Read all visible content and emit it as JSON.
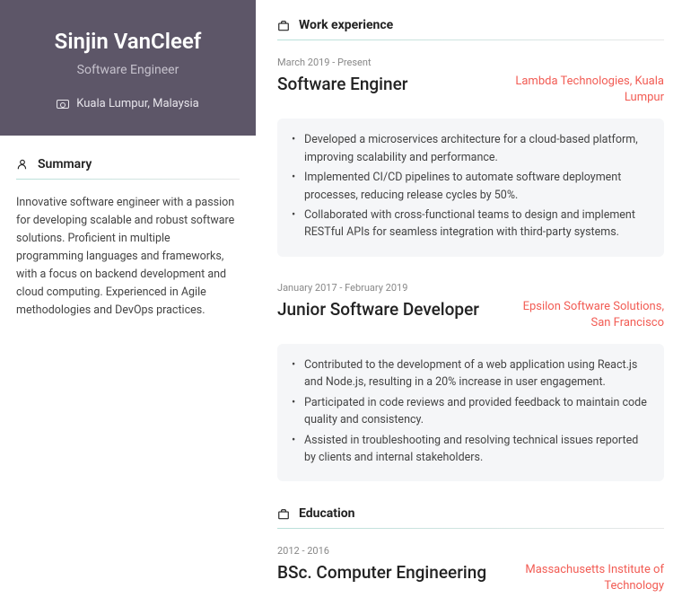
{
  "profile": {
    "name": "Sinjin VanCleef",
    "title": "Software Engineer",
    "location": "Kuala Lumpur, Malaysia"
  },
  "summary": {
    "heading": "Summary",
    "text": "Innovative software engineer with a passion for developing scalable and robust software solutions. Proficient in multiple programming languages and frameworks, with a focus on backend development and cloud computing. Experienced in Agile methodologies and DevOps practices."
  },
  "experience": {
    "heading": "Work experience",
    "jobs": [
      {
        "dates": "March 2019 - Present",
        "title": "Software Enginer",
        "company": "Lambda Technologies, Kuala Lumpur",
        "bullets": [
          "Developed a microservices architecture for a cloud-based platform, improving scalability and performance.",
          "Implemented CI/CD pipelines to automate software deployment processes, reducing release cycles by 50%.",
          "Collaborated with cross-functional teams to design and implement RESTful APIs for seamless integration with third-party systems."
        ]
      },
      {
        "dates": "January 2017 - February 2019",
        "title": "Junior Software Developer",
        "company": "Epsilon Software Solutions, San Francisco",
        "bullets": [
          "Contributed to the development of a web application using React.js and Node.js, resulting in a 20% increase in user engagement.",
          "Participated in code reviews and provided feedback to maintain code quality and consistency.",
          "Assisted in troubleshooting and resolving technical issues reported by clients and internal stakeholders."
        ]
      }
    ]
  },
  "education": {
    "heading": "Education",
    "entries": [
      {
        "dates": "2012 - 2016",
        "title": "BSc. Computer Engineering",
        "institution": "Massachusetts Institute of Technology"
      }
    ]
  }
}
